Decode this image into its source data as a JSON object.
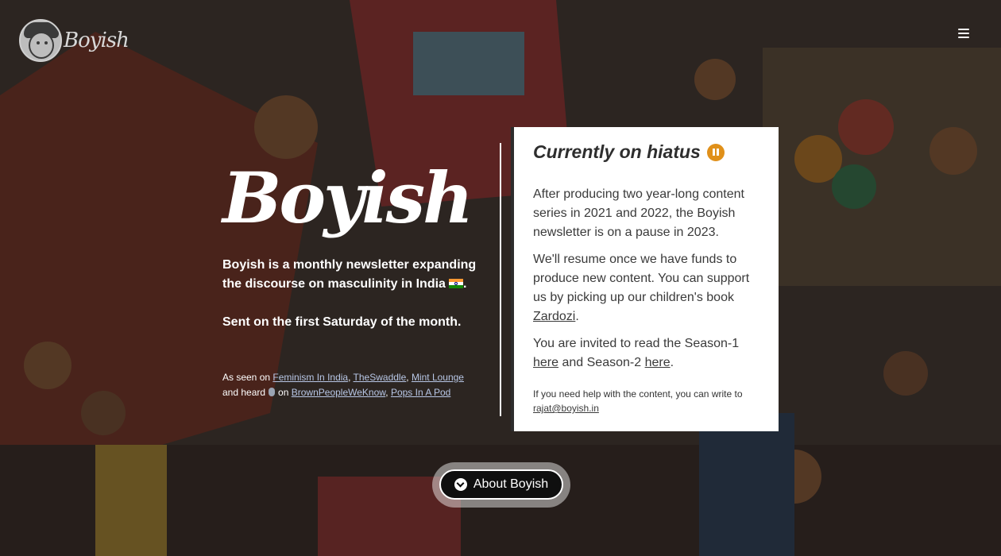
{
  "header": {
    "logo_text": "Boyish",
    "menu_icon": "hamburger-icon"
  },
  "intro": {
    "brand": "Boyish",
    "tagline": "Boyish is a monthly newsletter expanding the discourse on masculinity in India",
    "tagline_end": ".",
    "sent": "Sent on the first Saturday of the month.",
    "seen_prefix": "As seen on",
    "seen_links": [
      "Feminism In India",
      "TheSwaddle",
      "Mint Lounge"
    ],
    "heard_prefix": "and heard",
    "heard_on": "on",
    "heard_links": [
      "BrownPeopleWeKnow",
      "Pops In A Pod"
    ]
  },
  "hiatus": {
    "title": "Currently on hiatus",
    "para1": "After producing two year-long content series in 2021 and 2022, the Boyish newsletter is on a pause in 2023.",
    "para2_text": "We'll resume once we have funds to produce new content. You can support us by picking up our children's book",
    "para2_link": "Zardozi",
    "para2_end": ".",
    "para3_text": "You are invited to read the Season-1",
    "para3_link1": "here",
    "para3_mid": "and Season-2",
    "para3_link2": "here",
    "para3_end": ".",
    "help_text": "If you need help with the content, you can write to",
    "help_email": "rajat@boyish.in"
  },
  "about_button": {
    "label": "About Boyish",
    "icon": "chevron-down-circle-icon"
  },
  "colors": {
    "accent": "#e0901a",
    "background": "#3b3430",
    "link": "#b8c7e6"
  }
}
